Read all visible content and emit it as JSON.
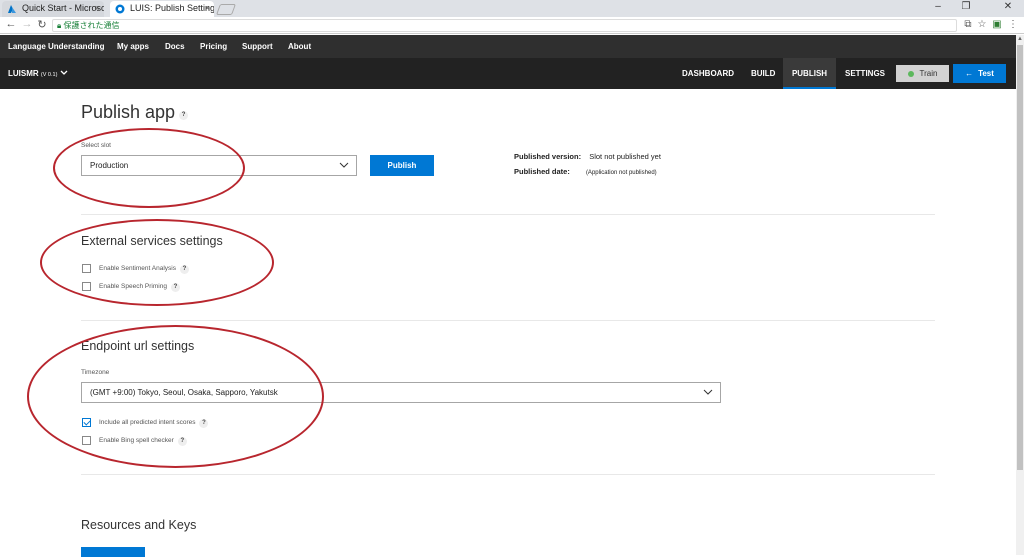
{
  "browser": {
    "tabs": [
      {
        "title": "Quick Start - Microsoft A",
        "close": "×"
      },
      {
        "title": "LUIS: Publish Settings",
        "close": "×"
      }
    ],
    "address_secure_label": "保護された通信",
    "window_controls": [
      "–",
      "❐",
      "✕"
    ]
  },
  "topnav": {
    "items": [
      "Language Understanding",
      "My apps",
      "Docs",
      "Pricing",
      "Support",
      "About"
    ]
  },
  "appbar": {
    "app_name": "LUISMR",
    "version": "(V 0.1)",
    "nav": [
      "DASHBOARD",
      "BUILD",
      "PUBLISH",
      "SETTINGS"
    ],
    "active_nav": "PUBLISH",
    "train_label": "Train",
    "test_label": "Test"
  },
  "page": {
    "title": "Publish app",
    "help": "?",
    "select_slot_label": "Select slot",
    "slot_value": "Production",
    "publish_button": "Publish",
    "published_version_label": "Published version:",
    "published_version_value": "Slot not published yet",
    "published_date_label": "Published date:",
    "published_date_value": "(Application not published)"
  },
  "external_services": {
    "title": "External services settings",
    "options": [
      {
        "label": "Enable Sentiment Analysis",
        "checked": false
      },
      {
        "label": "Enable Speech Priming",
        "checked": false
      }
    ]
  },
  "endpoint": {
    "title": "Endpoint url settings",
    "timezone_label": "Timezone",
    "timezone_value": "(GMT +9:00) Tokyo, Seoul, Osaka, Sapporo, Yakutsk",
    "options": [
      {
        "label": "Include all predicted intent scores",
        "checked": true
      },
      {
        "label": "Enable Bing spell checker",
        "checked": false
      }
    ]
  },
  "resources": {
    "title": "Resources and Keys"
  },
  "colors": {
    "accent": "#0078d4",
    "annotation": "#b8262e",
    "nav_dark": "#222222"
  }
}
